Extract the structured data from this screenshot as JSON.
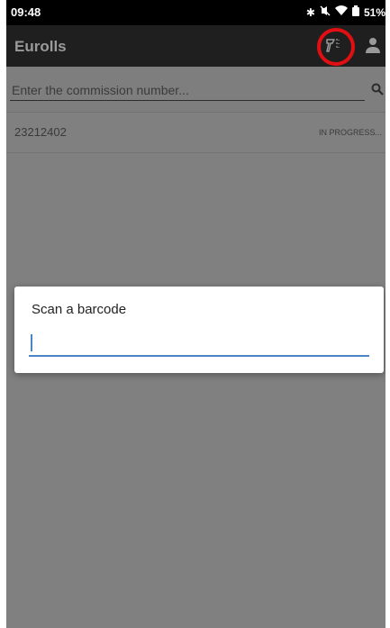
{
  "status_bar": {
    "time": "09:48",
    "battery": "51%",
    "icons": [
      "bluetooth-icon",
      "mute-icon",
      "wifi-icon",
      "battery-icon"
    ]
  },
  "app_bar": {
    "title": "Eurolls",
    "scan_button_icon": "barcode-scanner-icon",
    "profile_button_icon": "person-icon",
    "highlight_color": "#e10f12"
  },
  "search": {
    "placeholder": "Enter the commission number...",
    "value": "",
    "icon": "search-icon"
  },
  "list": {
    "items": [
      {
        "number": "23212402",
        "status": "IN PROGRESS..."
      }
    ]
  },
  "dialog": {
    "title": "Scan a barcode",
    "input_value": "",
    "accent_color": "#4b84c4"
  }
}
